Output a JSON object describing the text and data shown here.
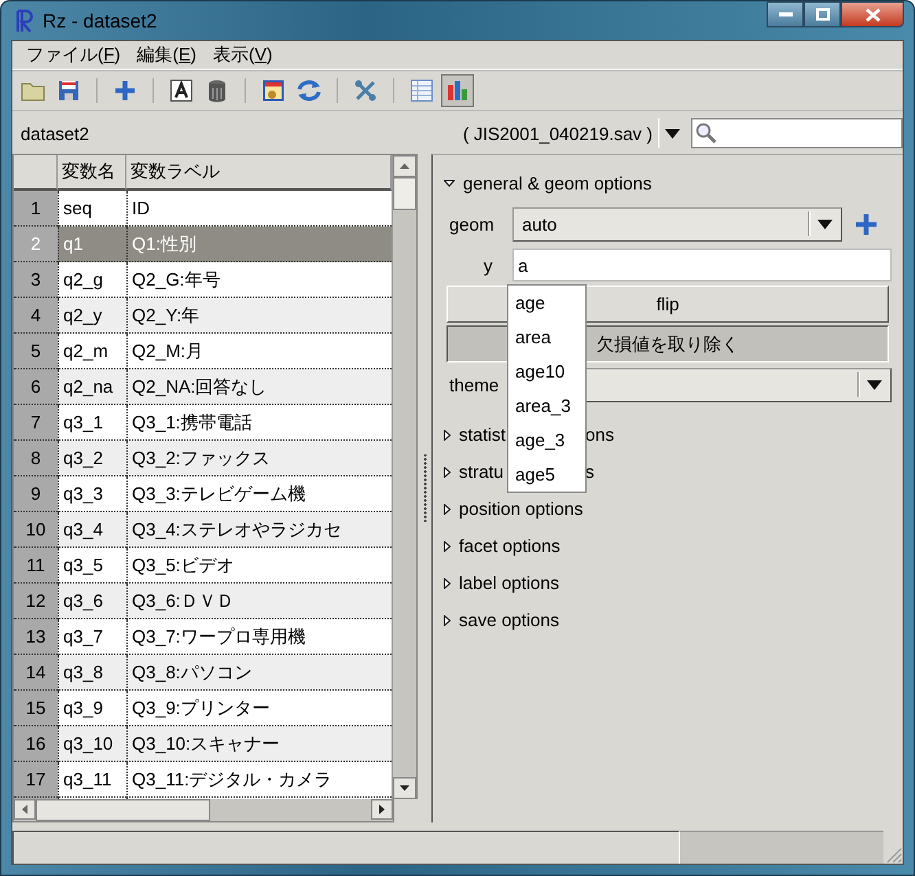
{
  "window": {
    "title": "Rz - dataset2"
  },
  "menu": [
    {
      "label": "ファイル(F)"
    },
    {
      "label": "編集(E)"
    },
    {
      "label": "表示(V)"
    }
  ],
  "toolbar": [
    {
      "kind": "open",
      "selected": false
    },
    {
      "kind": "save",
      "selected": false
    },
    {
      "kind": "sep"
    },
    {
      "kind": "add",
      "selected": false
    },
    {
      "kind": "sep"
    },
    {
      "kind": "text",
      "selected": false
    },
    {
      "kind": "trash",
      "selected": false
    },
    {
      "kind": "sep"
    },
    {
      "kind": "import",
      "selected": false
    },
    {
      "kind": "refresh",
      "selected": false
    },
    {
      "kind": "sep"
    },
    {
      "kind": "tools",
      "selected": false
    },
    {
      "kind": "sep"
    },
    {
      "kind": "table",
      "selected": false
    },
    {
      "kind": "chart",
      "selected": true
    }
  ],
  "dataset": {
    "name": "dataset2",
    "file": "( JIS2001_040219.sav )"
  },
  "table": {
    "columns": [
      "変数名",
      "変数ラベル"
    ],
    "rows": [
      {
        "num": "1",
        "name": "seq",
        "label": "ID",
        "selected": false
      },
      {
        "num": "2",
        "name": "q1",
        "label": "Q1:性別",
        "selected": true
      },
      {
        "num": "3",
        "name": "q2_g",
        "label": "Q2_G:年号",
        "selected": false
      },
      {
        "num": "4",
        "name": "q2_y",
        "label": "Q2_Y:年",
        "selected": false
      },
      {
        "num": "5",
        "name": "q2_m",
        "label": "Q2_M:月",
        "selected": false
      },
      {
        "num": "6",
        "name": "q2_na",
        "label": "Q2_NA:回答なし",
        "selected": false
      },
      {
        "num": "7",
        "name": "q3_1",
        "label": "Q3_1:携帯電話",
        "selected": false
      },
      {
        "num": "8",
        "name": "q3_2",
        "label": "Q3_2:ファックス",
        "selected": false
      },
      {
        "num": "9",
        "name": "q3_3",
        "label": "Q3_3:テレビゲーム機",
        "selected": false
      },
      {
        "num": "10",
        "name": "q3_4",
        "label": "Q3_4:ステレオやラジカセ",
        "selected": false
      },
      {
        "num": "11",
        "name": "q3_5",
        "label": "Q3_5:ビデオ",
        "selected": false
      },
      {
        "num": "12",
        "name": "q3_6",
        "label": "Q3_6:ＤＶＤ",
        "selected": false
      },
      {
        "num": "13",
        "name": "q3_7",
        "label": "Q3_7:ワープロ専用機",
        "selected": false
      },
      {
        "num": "14",
        "name": "q3_8",
        "label": "Q3_8:パソコン",
        "selected": false
      },
      {
        "num": "15",
        "name": "q3_9",
        "label": "Q3_9:プリンター",
        "selected": false
      },
      {
        "num": "16",
        "name": "q3_10",
        "label": "Q3_10:スキャナー",
        "selected": false
      },
      {
        "num": "17",
        "name": "q3_11",
        "label": "Q3_11:デジタル・カメラ",
        "selected": false
      }
    ]
  },
  "options": {
    "sections": [
      {
        "label": "general & geom options",
        "expanded": true
      },
      {
        "label": "statist",
        "label_tail": "ons",
        "expanded": false
      },
      {
        "label": "stratu",
        "label_tail": "s",
        "expanded": false
      },
      {
        "label": "position options",
        "expanded": false
      },
      {
        "label": "facet options",
        "expanded": false
      },
      {
        "label": "label options",
        "expanded": false
      },
      {
        "label": "save options",
        "expanded": false
      }
    ],
    "geom": {
      "label": "geom",
      "value": "auto"
    },
    "y": {
      "label": "y",
      "value": "a"
    },
    "buttons": [
      {
        "label": "flip",
        "pressed": false
      },
      {
        "label": "欠損値を取り除く",
        "pressed": true
      }
    ],
    "theme": {
      "label": "theme"
    },
    "suggestions": [
      "age",
      "area",
      "age10",
      "area_3",
      "age_3",
      "age5"
    ]
  }
}
